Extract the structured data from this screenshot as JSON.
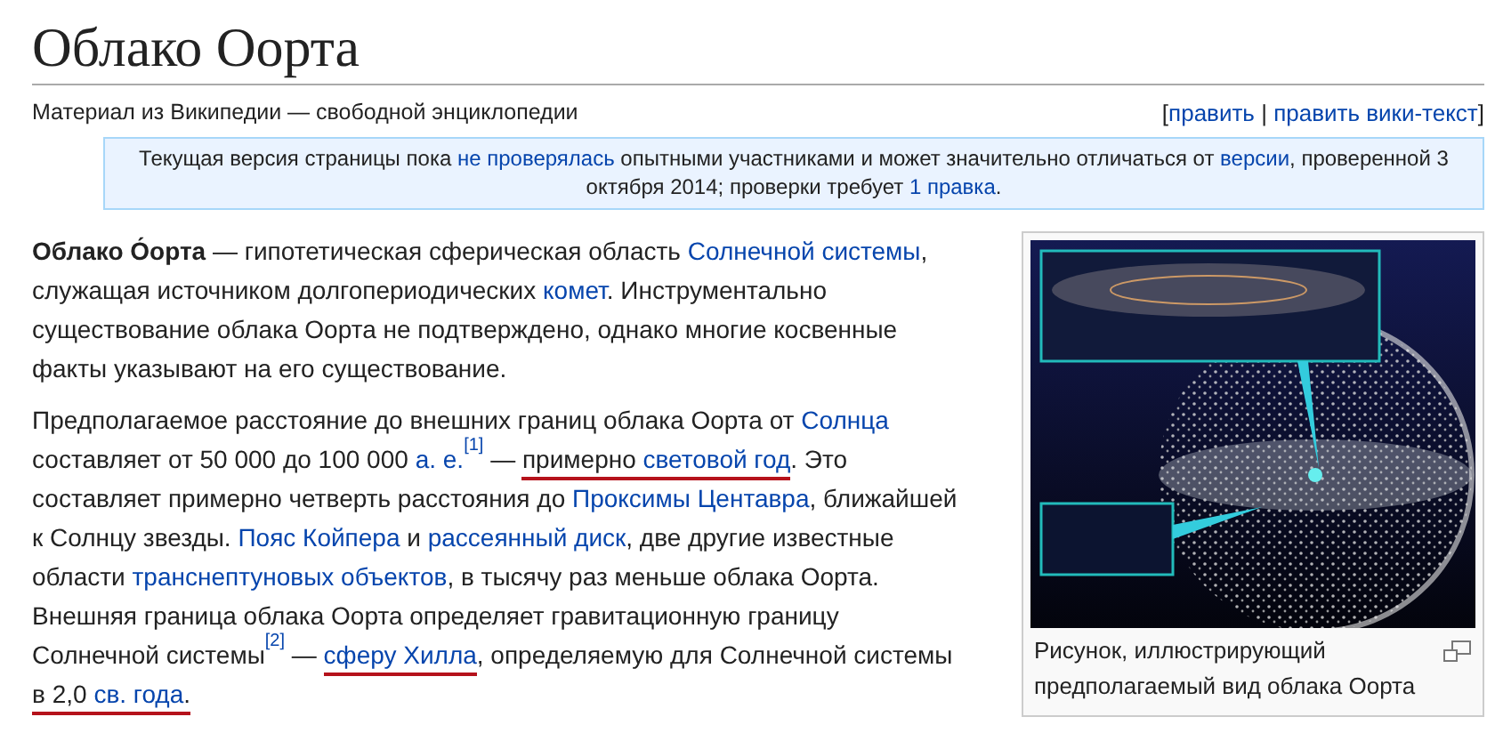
{
  "title": "Облако Оорта",
  "subtitle": "Материал из Википедии — свободной энциклопедии",
  "edit_links": [
    {
      "label": "править"
    },
    {
      "label": "править вики-текст"
    }
  ],
  "edit_brackets": {
    "open": "[",
    "separator": "|",
    "close": "]"
  },
  "notice": [
    {
      "kind": "text",
      "text": "Текущая версия страницы пока "
    },
    {
      "kind": "link",
      "text": "не проверялась"
    },
    {
      "kind": "text",
      "text": " опытными участниками и может значительно отличаться от "
    },
    {
      "kind": "link",
      "text": "версии"
    },
    {
      "kind": "text",
      "text": ", проверенной 3 октября 2014; проверки требует "
    },
    {
      "kind": "link",
      "text": "1 правка"
    },
    {
      "kind": "text",
      "text": "."
    }
  ],
  "paragraphs": [
    {
      "segments": [
        {
          "kind": "bold",
          "text": "Облако О́орта"
        },
        {
          "kind": "text",
          "text": " — гипотетическая сферическая область "
        },
        {
          "kind": "link",
          "text": "Солнечной системы"
        },
        {
          "kind": "text",
          "text": ", служащая источником долгопериодических "
        },
        {
          "kind": "link",
          "text": "комет"
        },
        {
          "kind": "text",
          "text": ". Инструментально существование облака Оорта не подтверждено, однако многие косвенные факты указывают на его существование."
        }
      ]
    },
    {
      "segments": [
        {
          "kind": "text",
          "text": "Предполагаемое расстояние до внешних границ облака Оорта от "
        },
        {
          "kind": "link",
          "text": "Солнца"
        },
        {
          "kind": "text",
          "text": " составляет от 50 000 до 100 000 "
        },
        {
          "kind": "link",
          "text": "а. е."
        },
        {
          "kind": "ref",
          "text": "[1]"
        },
        {
          "kind": "text",
          "text": " — "
        },
        {
          "kind": "text",
          "text": "примерно ",
          "underlined": true
        },
        {
          "kind": "link",
          "text": "световой год",
          "underlined": true
        },
        {
          "kind": "text",
          "text": ". Это составляет примерно четверть расстояния до "
        },
        {
          "kind": "link",
          "text": "Проксимы Центавра"
        },
        {
          "kind": "text",
          "text": ", ближайшей к Солнцу звезды. "
        },
        {
          "kind": "link",
          "text": "Пояс Койпера"
        },
        {
          "kind": "text",
          "text": " и "
        },
        {
          "kind": "link",
          "text": "рассеянный диск"
        },
        {
          "kind": "text",
          "text": ", две другие известные области "
        },
        {
          "kind": "link",
          "text": "транснептуновых объектов"
        },
        {
          "kind": "text",
          "text": ", в тысячу раз меньше облака Оорта. Внешняя граница облака Оорта определяет гравитационную границу Солнечной системы"
        },
        {
          "kind": "ref",
          "text": "[2]"
        },
        {
          "kind": "text",
          "text": " — "
        },
        {
          "kind": "link",
          "text": "сферу Хилла",
          "underlined": true
        },
        {
          "kind": "text",
          "text": ", определяемую для Солнечной системы "
        },
        {
          "kind": "text",
          "text": "в 2,0 ",
          "underlined": true
        },
        {
          "kind": "link",
          "text": "св. года",
          "underlined": true
        },
        {
          "kind": "text",
          "text": ".",
          "underlined": true
        }
      ]
    }
  ],
  "figure": {
    "kind": "picture",
    "caption": "Рисунок, иллюстрирующий предполагаемый вид облака Оорта"
  }
}
